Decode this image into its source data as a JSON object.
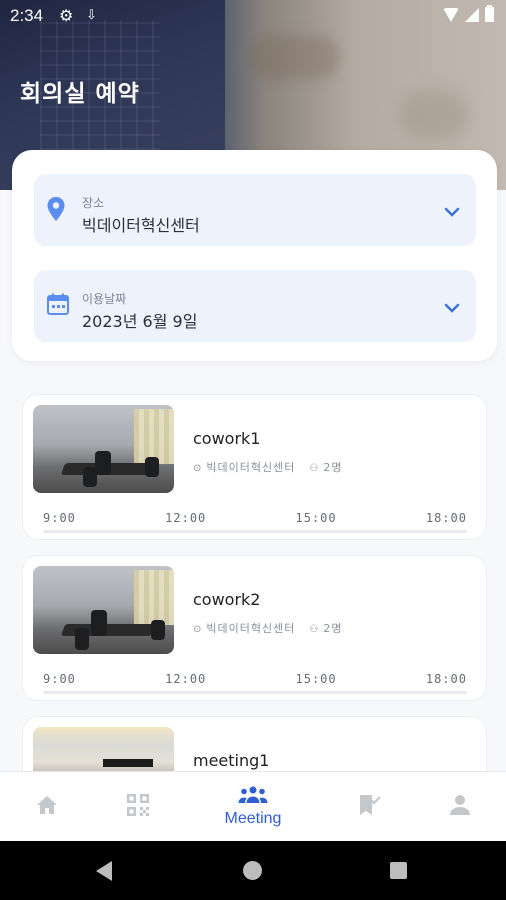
{
  "status_bar": {
    "time": "2:34"
  },
  "header": {
    "title": "회의실 예약"
  },
  "filters": {
    "location": {
      "label": "장소",
      "value": "빅데이터혁신센터"
    },
    "date": {
      "label": "이용날짜",
      "value": "2023년 6월 9일"
    }
  },
  "timeline_labels": [
    "9:00",
    "12:00",
    "15:00",
    "18:00"
  ],
  "rooms": [
    {
      "name": "cowork1",
      "location": "빅데이터혁신센터",
      "capacity": "2명"
    },
    {
      "name": "cowork2",
      "location": "빅데이터혁신센터",
      "capacity": "2명"
    },
    {
      "name": "meeting1"
    }
  ],
  "nav": {
    "items": [
      {
        "icon": "home-icon"
      },
      {
        "icon": "qr-code-icon"
      },
      {
        "icon": "people-icon",
        "label": "Meeting"
      },
      {
        "icon": "bookmark-check-icon"
      },
      {
        "icon": "person-icon"
      }
    ],
    "active_color": "#2f5fd3",
    "inactive_color": "#c4c7cc"
  },
  "colors": {
    "accent": "#5b8def",
    "select_bg": "#eef2fc"
  }
}
